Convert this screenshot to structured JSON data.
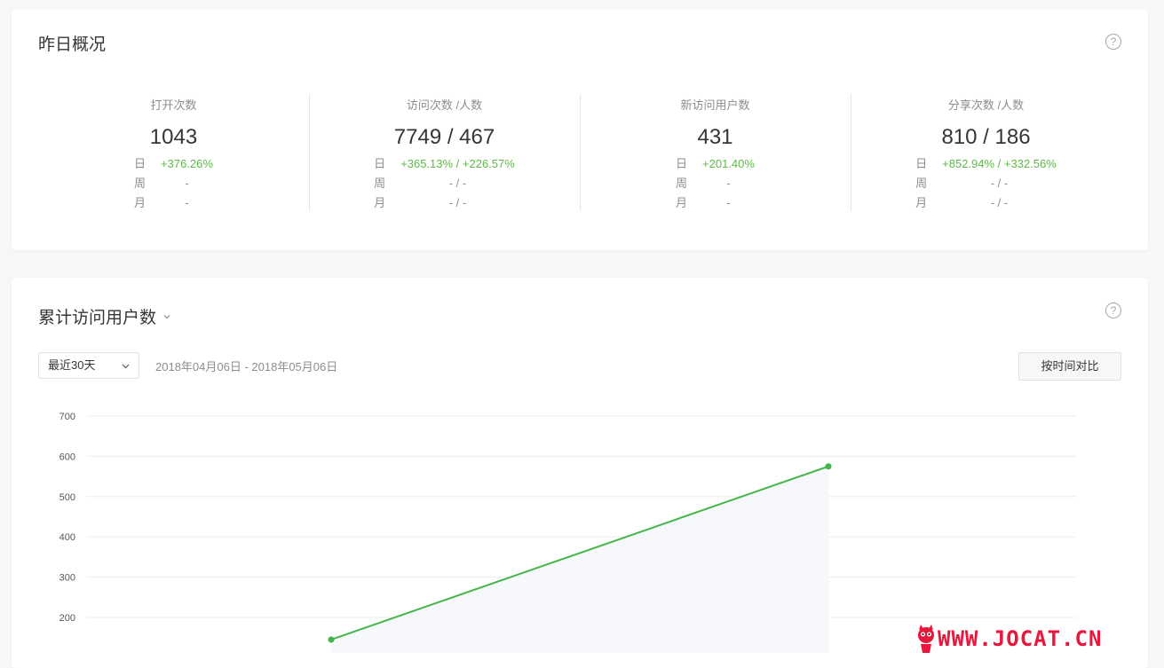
{
  "overview": {
    "title": "昨日概况",
    "stats": [
      {
        "label": "打开次数",
        "value": "1043",
        "rows": [
          {
            "k": "日",
            "v": "+376.26%",
            "up": true
          },
          {
            "k": "周",
            "v": "-",
            "up": false
          },
          {
            "k": "月",
            "v": "-",
            "up": false
          }
        ]
      },
      {
        "label": "访问次数 /人数",
        "value": "7749 / 467",
        "rows": [
          {
            "k": "日",
            "v": "+365.13% / +226.57%",
            "up": true
          },
          {
            "k": "周",
            "v": "- / -",
            "up": false
          },
          {
            "k": "月",
            "v": "- / -",
            "up": false
          }
        ]
      },
      {
        "label": "新访问用户数",
        "value": "431",
        "rows": [
          {
            "k": "日",
            "v": "+201.40%",
            "up": true
          },
          {
            "k": "周",
            "v": "-",
            "up": false
          },
          {
            "k": "月",
            "v": "-",
            "up": false
          }
        ]
      },
      {
        "label": "分享次数 /人数",
        "value": "810 / 186",
        "rows": [
          {
            "k": "日",
            "v": "+852.94% / +332.56%",
            "up": true
          },
          {
            "k": "周",
            "v": "- / -",
            "up": false
          },
          {
            "k": "月",
            "v": "- / -",
            "up": false
          }
        ]
      }
    ]
  },
  "trend": {
    "title": "累计访问用户数",
    "range_select": "最近30天",
    "date_range": "2018年04月06日 - 2018年05月06日",
    "compare_button": "按时间对比"
  },
  "chart_data": {
    "type": "line",
    "yticks": [
      200,
      300,
      400,
      500,
      600,
      700
    ],
    "series": [
      {
        "values": [
          145,
          575
        ]
      }
    ],
    "color": "#45b649"
  },
  "watermark": "WWW.JOCAT.CN",
  "colors": {
    "accent": "#5fb948",
    "line": "#45b649"
  }
}
